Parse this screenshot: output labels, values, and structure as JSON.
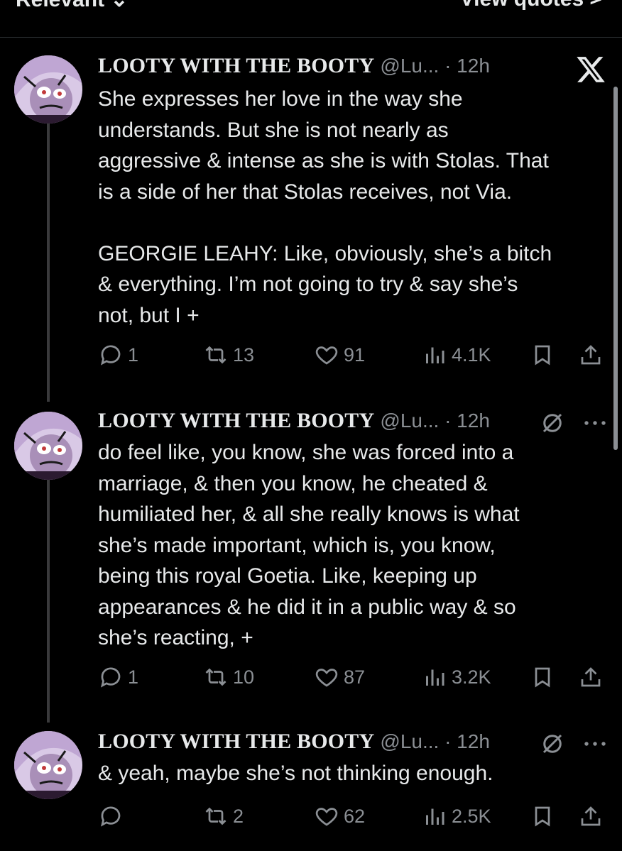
{
  "topbar": {
    "left_label": "Relevant ⌄",
    "right_label": "View quotes >"
  },
  "app": {
    "logo": "x-logo-icon"
  },
  "posts": [
    {
      "name": "LOOTY WITH THE BOOTY",
      "handle": "@Lu... · 12h",
      "text": "She expresses her love in the way she\nunderstands. But she is not nearly as\naggressive & intense as she is with Stolas. That\nis a side of her that Stolas receives, not Via.\n\nGEORGIE LEAHY: Like, obviously, she’s a bitch\n& everything. I’m not going to try & say she’s\nnot, but I +",
      "replies": "1",
      "reposts": "13",
      "likes": "91",
      "views": "4.1K"
    },
    {
      "name": "LOOTY WITH THE BOOTY",
      "handle": "@Lu... · 12h",
      "text": "do feel like, you know, she was forced into a\nmarriage, & then you know, he cheated &\nhumiliated her, & all she really knows is what\nshe’s made important, which is, you know,\nbeing this royal Goetia. Like, keeping up\nappearances & he did it in a public way & so\nshe’s reacting, +",
      "replies": "1",
      "reposts": "10",
      "likes": "87",
      "views": "3.2K"
    },
    {
      "name": "LOOTY WITH THE BOOTY",
      "handle": "@Lu... · 12h",
      "text": "& yeah, maybe she’s not thinking enough.",
      "replies": "",
      "reposts": "2",
      "likes": "62",
      "views": "2.5K"
    }
  ],
  "colors": {
    "background": "#000000",
    "text": "#e7e9ea",
    "muted": "#8b8f94",
    "thread_line": "#3a3a3c"
  }
}
